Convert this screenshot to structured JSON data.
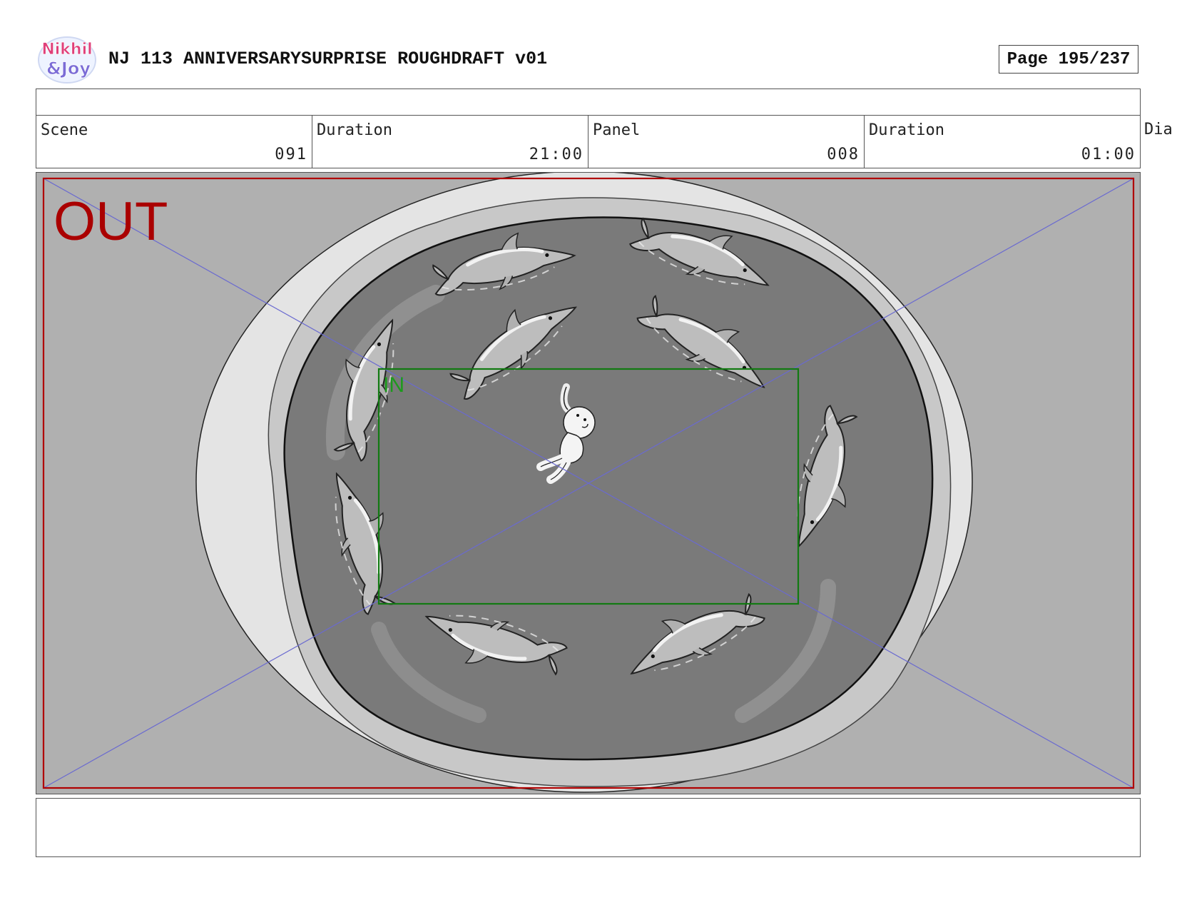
{
  "header": {
    "logo_text_top": "Nikhil",
    "logo_text_bottom": "&Joy",
    "title": "NJ 113 ANNIVERSARYSURPRISE ROUGHDRAFT v01",
    "page_label": "Page 195/237"
  },
  "fields": {
    "scene_label": "Scene",
    "scene_value": "091",
    "scene_duration_label": "Duration",
    "scene_duration_value": "21:00",
    "panel_label": "Panel",
    "panel_value": "008",
    "panel_duration_label": "Duration",
    "panel_duration_value": "01:00",
    "dialogue_label": "Dia"
  },
  "panel": {
    "out_label": "OUT",
    "in_label": "IN",
    "colors": {
      "out_frame": "#b00000",
      "in_frame": "#127a12",
      "guide_lines": "#6a6ad0",
      "water": "#7a7a7a",
      "background": "#b0b0b0"
    }
  }
}
